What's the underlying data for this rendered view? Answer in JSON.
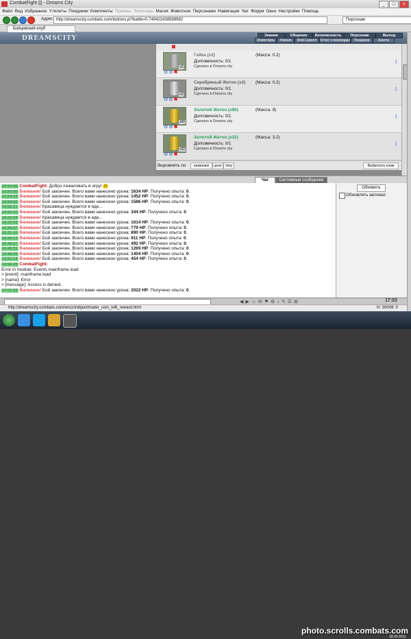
{
  "window": {
    "title": "CombatFight ||| - Dreams City",
    "btn_min": "_",
    "btn_max": "□",
    "btn_close": "×"
  },
  "menu": {
    "items": [
      "Файл",
      "Вид",
      "Избранное",
      "Утилиты",
      "Поединки",
      "Комплекты",
      "Приёмы",
      "Эликсиры",
      "Магия",
      "Животное",
      "Персонажи",
      "Навигация",
      "Чат",
      "Форум",
      "Окно",
      "Настройки",
      "Помощь"
    ],
    "dimmed": [
      "Приёмы",
      "Эликсиры"
    ]
  },
  "nav": {
    "address_label": "Адрес",
    "url": "http://dreamscity.combats.com/buttons.pl?battle=0.749422438589982",
    "search_placeholder": "Персонаж"
  },
  "tab": {
    "label": "Бойцовский клуб"
  },
  "game_header": {
    "logo": "DREAMSCITY",
    "nav_top": [
      "Знания",
      "Общение",
      "Безопасность",
      "Персонаж",
      "Выход"
    ],
    "nav_bottom": [
      "Инвентарь",
      "Умения",
      "Мой Скролл",
      "Отчет о переводах",
      "Поединки",
      "Анкета"
    ]
  },
  "inventory": {
    "items": [
      {
        "name": "Гайка (x2)",
        "mass": "(Масса: 0.2)",
        "durability": "Долговечность: 0/1",
        "made": "Сделано в Dreams city",
        "count": "x2",
        "style": "gr",
        "coin": "gray"
      },
      {
        "name": "Серебряный Жетон (x2)",
        "mass": "(Масса: 0.2)",
        "durability": "Долговечность: 0/1",
        "made": "Сделано в Dreams city",
        "count": "x2",
        "style": "silvn",
        "coin": "silv"
      },
      {
        "name": "Золотой Жетон (x90)",
        "mass": "(Масса: 9)",
        "durability": "Долговечность: 0/1",
        "made": "Сделано в Dreams city",
        "count": "x90",
        "style": "green",
        "coin": "gld"
      },
      {
        "name": "Золотой Жетон (x32)",
        "mass": "(Масса: 3.2)",
        "durability": "Долговечность: 0/1",
        "made": "Сделано в Dreams city",
        "count": "x32",
        "style": "green",
        "coin": "gld"
      }
    ],
    "sort_label": "Выровнять по",
    "sort_buttons": [
      "названию",
      "цене",
      "типу"
    ],
    "drop_all": "Выбросить хлам"
  },
  "chat_tabs": [
    "Чат",
    "Системные сообщения"
  ],
  "chat": [
    {
      "ts": "15:52:00",
      "prefix": "CombatFight:",
      "prefix_style": "cf",
      "text": " Добро пожаловать в игру! ",
      "hp": "",
      "xp": ""
    },
    {
      "ts": "15:53:50",
      "prefix": "Внимание!",
      "prefix_style": "warn",
      "text": " Бой закончен. Всего вами нанесено урона: ",
      "hp": "1634 HP",
      "xp": "0"
    },
    {
      "ts": "15:54:23",
      "prefix": "Внимание!",
      "prefix_style": "warn",
      "text": " Бой закончен. Всего вами нанесено урона: ",
      "hp": "1452 HP",
      "xp": "0"
    },
    {
      "ts": "15:54:50",
      "prefix": "Внимание!",
      "prefix_style": "warn",
      "text": " Бой закончен. Всего вами нанесено урона: ",
      "hp": "1586 HP",
      "xp": "0"
    },
    {
      "ts": "15:55:21",
      "prefix": "Внимание!",
      "prefix_style": "warn",
      "text": " Красавица нуждается в еде...",
      "hp": "",
      "xp": ""
    },
    {
      "ts": "15:56:10",
      "prefix": "Внимание!",
      "prefix_style": "warn",
      "text": " Бой закончен. Всего вами нанесено урона: ",
      "hp": "344 HP",
      "xp": "0"
    },
    {
      "ts": "16:21:04",
      "prefix": "Внимание!",
      "prefix_style": "warn",
      "text": " Красавица нуждается в еде...",
      "hp": "",
      "xp": ""
    },
    {
      "ts": "16:23:33",
      "prefix": "Внимание!",
      "prefix_style": "warn",
      "text": " Бой закончен. Всего вами нанесено урона: ",
      "hp": "1614 HP",
      "xp": "0"
    },
    {
      "ts": "16:26:07",
      "prefix": "Внимание!",
      "prefix_style": "warn",
      "text": " Бой закончен. Всего вами нанесено урона: ",
      "hp": "779 HP",
      "xp": "0"
    },
    {
      "ts": "16:31:10",
      "prefix": "Внимание!",
      "prefix_style": "warn",
      "text": " Бой закончен. Всего вами нанесено урона: ",
      "hp": "890 HP",
      "xp": "0"
    },
    {
      "ts": "16:34:12",
      "prefix": "Внимание!",
      "prefix_style": "warn",
      "text": " Бой закончен. Всего вами нанесено урона: ",
      "hp": "911 HP",
      "xp": "0"
    },
    {
      "ts": "16:40:27",
      "prefix": "Внимание!",
      "prefix_style": "warn",
      "text": " Бой закончен. Всего вами нанесено урона: ",
      "hp": "492 HP",
      "xp": "0"
    },
    {
      "ts": "16:45:31",
      "prefix": "Внимание!",
      "prefix_style": "warn",
      "text": " Бой закончен. Всего вами нанесено урона: ",
      "hp": "1269 HP",
      "xp": "0"
    },
    {
      "ts": "16:49:25",
      "prefix": "Внимание!",
      "prefix_style": "warn",
      "text": " Бой закончен. Всего вами нанесено урона: ",
      "hp": "1404 HP",
      "xp": "0"
    },
    {
      "ts": "16:52:14",
      "prefix": "Внимание!",
      "prefix_style": "warn",
      "text": " Бой закончен. Всего вами нанесено урона: ",
      "hp": "454 HP",
      "xp": "0"
    },
    {
      "ts": "16:56:25",
      "prefix": "CombatFight:",
      "prefix_style": "cf",
      "text": "",
      "hp": "",
      "xp": ""
    },
    {
      "ts": "",
      "prefix": "",
      "prefix_style": "",
      "text": "Error in module: Events mainframe.load",
      "hp": "",
      "xp": ""
    },
    {
      "ts": "",
      "prefix": "",
      "prefix_style": "",
      "text": "> [event]: mainframe.load",
      "hp": "",
      "xp": ""
    },
    {
      "ts": "",
      "prefix": "",
      "prefix_style": "",
      "text": "> [name]: Error",
      "hp": "",
      "xp": ""
    },
    {
      "ts": "",
      "prefix": "",
      "prefix_style": "",
      "text": "> [message]: Access is denied.",
      "hp": "",
      "xp": ""
    },
    {
      "ts": "17:01:33",
      "prefix": "Внимание!",
      "prefix_style": "warn",
      "text": " Бой закончен. Всего вами нанесено урона: ",
      "hp": "2022 HP",
      "xp": "0"
    }
  ],
  "chat_labels": {
    "xp_prefix": ". Получено опыта: ",
    "xp_suffix": "."
  },
  "right_panel": {
    "refresh": "Обновить",
    "auto_label": "Обновлять автомат."
  },
  "bottom": {
    "clock": "17:03"
  },
  "status": {
    "url": "http://dreamscity.combats.com/encicl/object/mater_coin_lvl6_reward.html",
    "hp": "Н: 300/М: 0"
  },
  "watermark": {
    "text": "photo.scrolls.combats.com",
    "date": "18.03.2011"
  }
}
